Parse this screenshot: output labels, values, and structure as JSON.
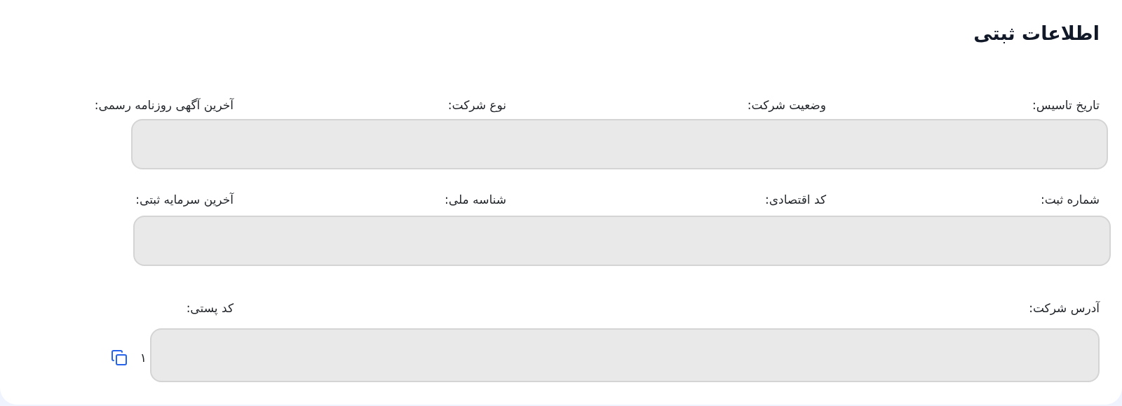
{
  "title": "اطلاعات ثبتی",
  "rows": [
    {
      "masked": true,
      "fields": [
        {
          "kind": "field",
          "label": "تاریخ تاسیس:"
        },
        {
          "kind": "field",
          "label": "وضعیت شرکت:"
        },
        {
          "kind": "field",
          "label": "نوع شرکت:"
        },
        {
          "kind": "field",
          "label": "آخرین آگهی روزنامه رسمی:"
        }
      ]
    },
    {
      "masked": true,
      "fields": [
        {
          "kind": "field",
          "label": "شماره ثبت:"
        },
        {
          "kind": "field",
          "label": "کد اقتصادی:"
        },
        {
          "kind": "field",
          "label": "شناسه ملی:"
        },
        {
          "kind": "field",
          "label": "آخرین سرمایه ثبتی:"
        }
      ]
    },
    {
      "masked": true,
      "fields": [
        {
          "kind": "wide",
          "label": "آدرس شرکت:"
        },
        {
          "kind": "field",
          "label": "کد پستی:",
          "value": "۱",
          "copy_button": true
        }
      ]
    }
  ]
}
